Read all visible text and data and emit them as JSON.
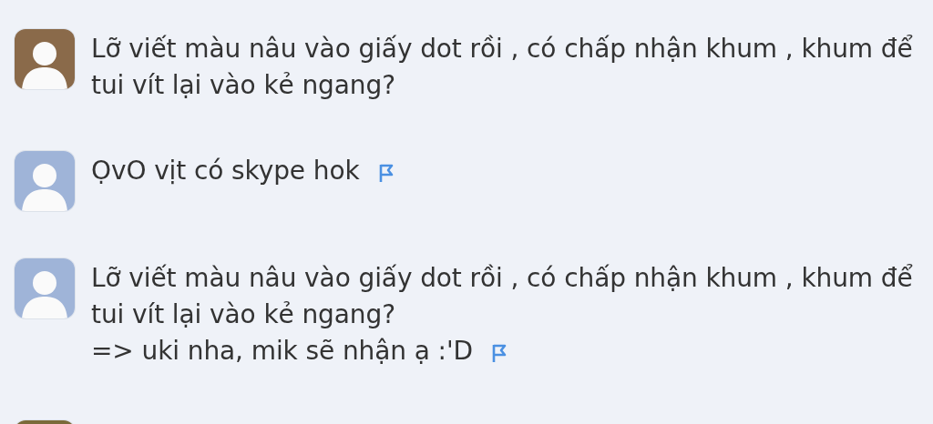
{
  "messages": [
    {
      "color": "#8a6a4a",
      "lines": [
        "Lỡ viết màu nâu vào giấy dot rồi , có chấp nhận khum , khum để tui vít lại vào kẻ ngang?"
      ],
      "flag_icon": false
    },
    {
      "color": "#9fb4d8",
      "lines": [
        "ỌvO vịt có skype hok"
      ],
      "flag_icon": true
    },
    {
      "color": "#9fb4d8",
      "lines": [
        "Lỡ viết màu nâu vào giấy dot rồi , có chấp nhận khum , khum để tui vít lại vào kẻ ngang?",
        "=> uki nha, mik sẽ nhận ạ :'D"
      ],
      "flag_icon": true
    },
    {
      "color": "#7a6a3a"
    }
  ]
}
